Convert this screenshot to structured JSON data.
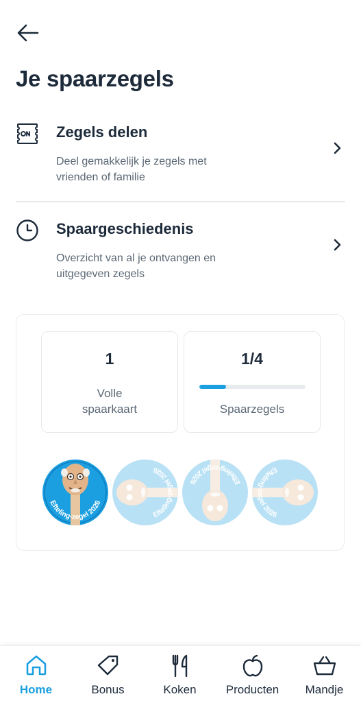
{
  "header": {
    "title": "Je spaarzegels",
    "back_icon": "arrow-left-icon"
  },
  "menu": [
    {
      "title": "Zegels delen",
      "description": "Deel gemakkelijk je zegels met vrienden of familie",
      "icon": "share-stamps-icon"
    },
    {
      "title": "Spaargeschiedenis",
      "description": "Overzicht van al je ontvangen en uitgegeven zegels",
      "icon": "clock-icon"
    }
  ],
  "summary": {
    "full_cards": {
      "value": "1",
      "label": "Volle spaarkaart"
    },
    "stamps": {
      "value": "1/4",
      "label": "Spaarzegels",
      "progress_fraction": 0.25
    }
  },
  "stamps": [
    {
      "text": "Efteling-zegel 2026",
      "collected": true
    },
    {
      "text": "Efteling-zegel 2026",
      "collected": false
    },
    {
      "text": "Efteling-zegel 2026",
      "collected": false
    },
    {
      "text": "Efteling-zegel 2026",
      "collected": false
    }
  ],
  "nav": {
    "items": [
      {
        "label": "Home",
        "icon": "home-icon",
        "active": true
      },
      {
        "label": "Bonus",
        "icon": "tag-icon",
        "active": false
      },
      {
        "label": "Koken",
        "icon": "fork-knife-icon",
        "active": false
      },
      {
        "label": "Producten",
        "icon": "apple-icon",
        "active": false
      },
      {
        "label": "Mandje",
        "icon": "basket-icon",
        "active": false
      }
    ]
  },
  "colors": {
    "accent": "#1b9fe0",
    "text": "#1c2a3a",
    "muted": "#5b6875"
  }
}
